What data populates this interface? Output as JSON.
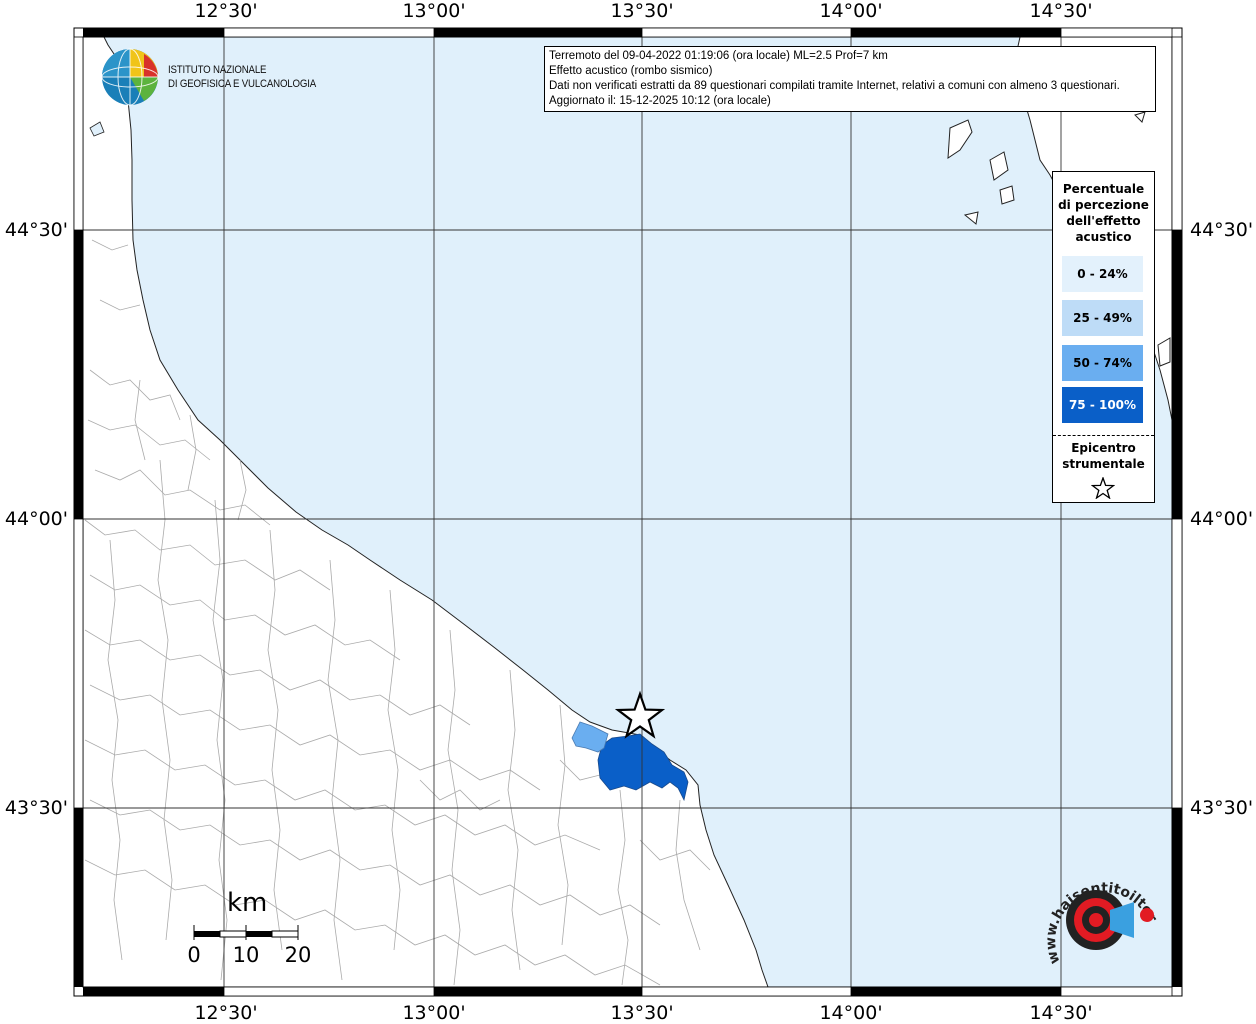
{
  "map": {
    "colors": {
      "sea": "#e0f0fb",
      "land": "#ffffff",
      "border": "#aaaaaa",
      "grid": "#333333"
    },
    "longitude_labels": [
      "12°30'",
      "13°00'",
      "13°30'",
      "14°00'",
      "14°30'"
    ],
    "latitude_labels": [
      "44°30'",
      "44°00'",
      "43°30'"
    ]
  },
  "info": {
    "line1": "Terremoto del 09-04-2022 01:19:06 (ora locale) ML=2.5 Prof=7 km",
    "line2": "Effetto acustico (rombo sismico)",
    "line3": "Dati non verificati estratti da 89 questionari compilati tramite Internet, relativi a comuni con almeno 3 questionari.",
    "line4": "Aggiornato il: 15-12-2025 10:12 (ora locale)"
  },
  "legend": {
    "title_lines": [
      "Percentuale",
      "di percezione",
      "dell'effetto",
      "acustico"
    ],
    "items": [
      {
        "label": "0 - 24%",
        "color": "#e3f1fc",
        "text_color": "#000000"
      },
      {
        "label": "25 - 49%",
        "color": "#bedcf7",
        "text_color": "#000000"
      },
      {
        "label": "50 - 74%",
        "color": "#6aaef0",
        "text_color": "#000000"
      },
      {
        "label": "75 - 100%",
        "color": "#0a5fc8",
        "text_color": "#ffffff"
      }
    ],
    "epicenter_lines": [
      "Epicentro",
      "strumentale"
    ]
  },
  "logo": {
    "line1": "ISTITUTO NAZIONALE",
    "line2": "DI GEOFISICA E VULCANOLOGIA"
  },
  "scale_bar": {
    "unit": "km",
    "labels": [
      "0",
      "10",
      "20"
    ]
  },
  "hsit_logo": {
    "text": "www.haisentitoilterremoto.it"
  }
}
